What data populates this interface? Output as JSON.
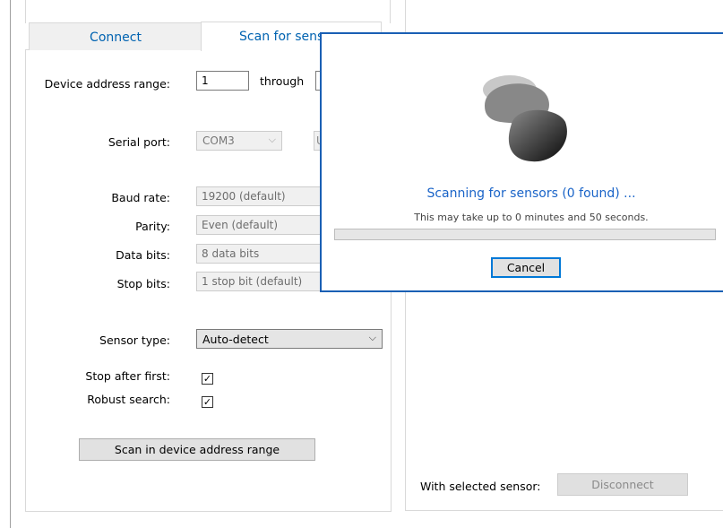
{
  "tabs": {
    "connect": "Connect",
    "scan": "Scan for sensors"
  },
  "address": {
    "label": "Device address range:",
    "from": "1",
    "through_label": "through",
    "to": ""
  },
  "serial": {
    "label": "Serial port:",
    "value": "COM3",
    "button": "U"
  },
  "baud": {
    "label": "Baud rate:",
    "value": "19200 (default)"
  },
  "parity": {
    "label": "Parity:",
    "value": "Even (default)"
  },
  "databits": {
    "label": "Data bits:",
    "value": "8 data bits"
  },
  "stopbits": {
    "label": "Stop bits:",
    "value": "1 stop bit (default)"
  },
  "sensor": {
    "label": "Sensor type:",
    "value": "Auto-detect"
  },
  "stop_first": {
    "label": "Stop after first:",
    "checked": true
  },
  "robust": {
    "label": "Robust search:",
    "checked": true
  },
  "scan_button": "Scan in device address range",
  "right": {
    "with_label": "With selected sensor:",
    "disconnect": "Disconnect"
  },
  "dialog": {
    "title": "Scanning for sensors (0 found) ...",
    "subtitle": "This may take up to 0 minutes and 50 seconds.",
    "progress": 0,
    "cancel": "Cancel"
  },
  "colors": {
    "accent": "#1a64c8",
    "dialog_border": "#1a5fb4",
    "focus": "#0078d7"
  },
  "glyphs": {
    "check": "✓",
    "chevron": "⌵"
  }
}
